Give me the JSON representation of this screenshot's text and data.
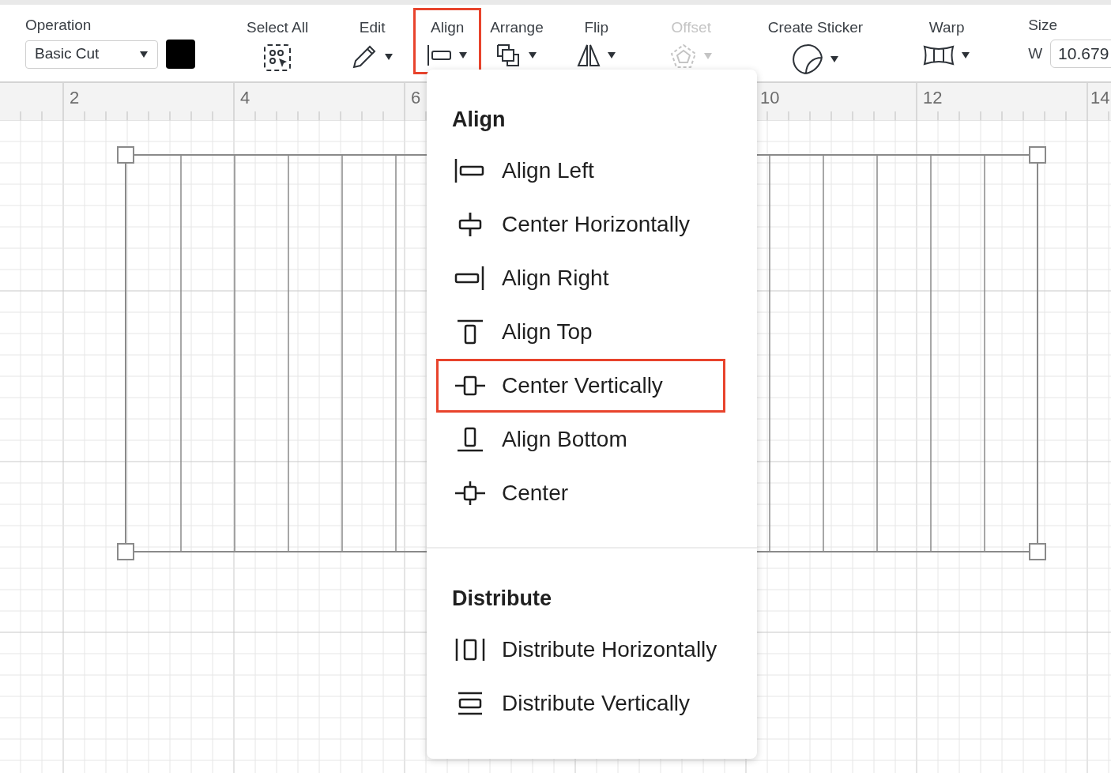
{
  "toolbar": {
    "operation": {
      "label": "Operation",
      "value": "Basic Cut",
      "color": "#000000"
    },
    "tool_groups": [
      {
        "tools": [
          {
            "kind": "select-all",
            "label": "Select All",
            "dropdown": false,
            "disabled": false,
            "highlighted": false
          },
          {
            "kind": "edit",
            "label": "Edit",
            "dropdown": true,
            "disabled": false,
            "highlighted": false
          }
        ]
      },
      {
        "tools": [
          {
            "kind": "align",
            "label": "Align",
            "dropdown": true,
            "disabled": false,
            "highlighted": true
          },
          {
            "kind": "arrange",
            "label": "Arrange",
            "dropdown": true,
            "disabled": false,
            "highlighted": false
          },
          {
            "kind": "flip",
            "label": "Flip",
            "dropdown": true,
            "disabled": false,
            "highlighted": false
          }
        ]
      },
      {
        "tools": [
          {
            "kind": "offset",
            "label": "Offset",
            "dropdown": true,
            "disabled": true,
            "highlighted": false
          }
        ]
      },
      {
        "tools": [
          {
            "kind": "sticker",
            "label": "Create Sticker",
            "dropdown": true,
            "disabled": false,
            "highlighted": false
          }
        ]
      },
      {
        "tools": [
          {
            "kind": "warp",
            "label": "Warp",
            "dropdown": true,
            "disabled": false,
            "highlighted": false
          }
        ]
      }
    ],
    "size": {
      "label": "Size",
      "axis": "W",
      "value": "10.679"
    }
  },
  "ruler": {
    "labels": [
      "2",
      "4",
      "6",
      "10",
      "12",
      "14"
    ]
  },
  "align_menu": {
    "sections": [
      {
        "title": "Align",
        "items": [
          {
            "kind": "align-left",
            "label": "Align Left",
            "highlighted": false
          },
          {
            "kind": "center-horizontally",
            "label": "Center Horizontally",
            "highlighted": false
          },
          {
            "kind": "align-right",
            "label": "Align Right",
            "highlighted": false
          },
          {
            "kind": "align-top",
            "label": "Align Top",
            "highlighted": false
          },
          {
            "kind": "center-vertically",
            "label": "Center Vertically",
            "highlighted": true
          },
          {
            "kind": "align-bottom",
            "label": "Align Bottom",
            "highlighted": false
          },
          {
            "kind": "center",
            "label": "Center",
            "highlighted": false
          }
        ]
      },
      {
        "title": "Distribute",
        "items": [
          {
            "kind": "distribute-horizontally",
            "label": "Distribute Horizontally",
            "highlighted": false
          },
          {
            "kind": "distribute-vertically",
            "label": "Distribute Vertically",
            "highlighted": false
          }
        ]
      }
    ]
  }
}
